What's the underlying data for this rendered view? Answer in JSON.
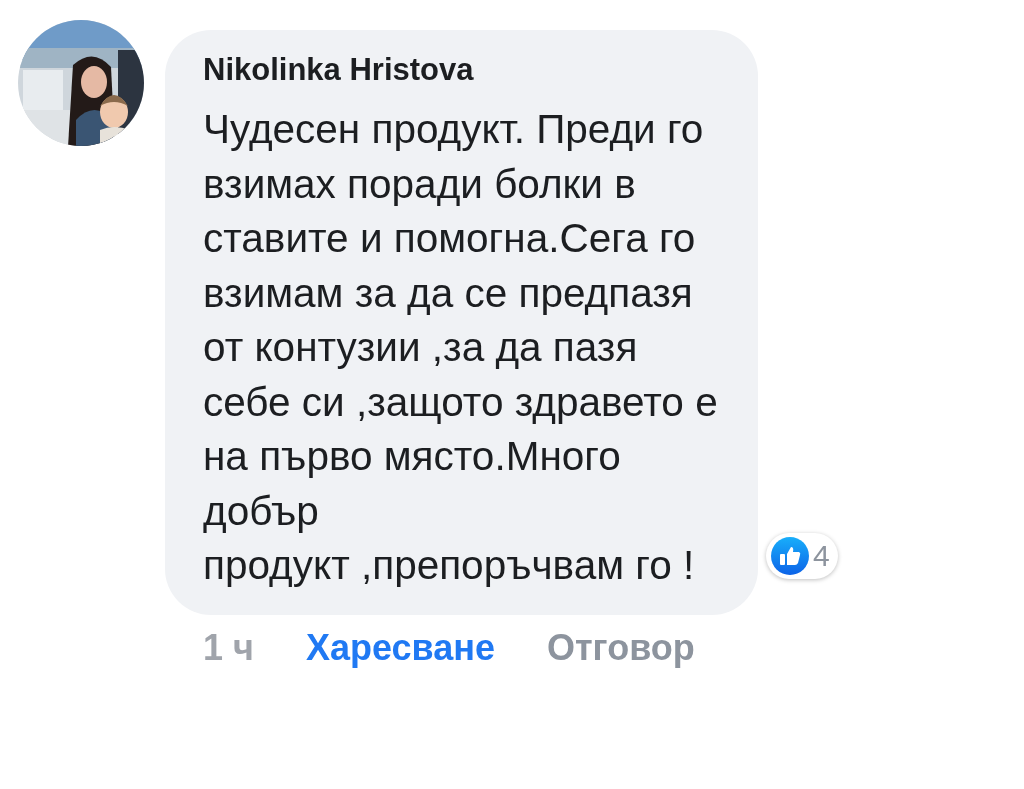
{
  "comment": {
    "author": "Nikolinka Hristova",
    "text": "Чудесен продукт. Преди го\nвзимах поради болки в\nставите и помогна.Сега го\nвзимам за да се предпазя\nот контузии ,за да пазя\nсебе си ,защото здравето е\nна първо място.Много\nдобър\nпродукт ,препоръчвам го !",
    "reactions": {
      "count": "4"
    },
    "time": "1 ч",
    "actions": [
      {
        "label": "Харесване",
        "selected": true
      },
      {
        "label": "Отговор",
        "selected": false
      }
    ]
  }
}
